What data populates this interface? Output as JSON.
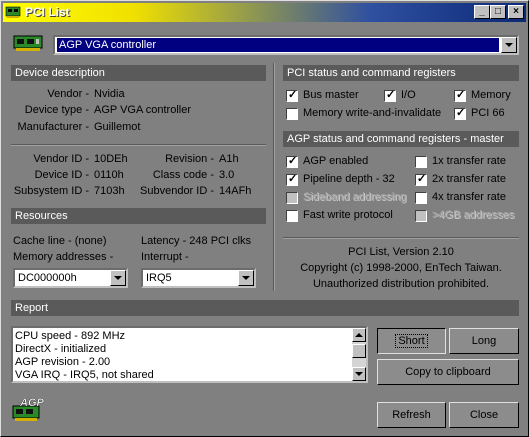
{
  "window": {
    "title": "PCI List",
    "controls": [
      "_",
      "□",
      "×"
    ]
  },
  "device_select": {
    "value": "AGP VGA controller"
  },
  "device_description": {
    "header": "Device description",
    "vendor_label": "Vendor -",
    "vendor": "Nvidia",
    "type_label": "Device type -",
    "type": "AGP VGA controller",
    "manufacturer_label": "Manufacturer -",
    "manufacturer": "Guillemot"
  },
  "ids": {
    "vendor_id_label": "Vendor ID -",
    "vendor_id": "10DEh",
    "device_id_label": "Device ID -",
    "device_id": "0110h",
    "subsystem_id_label": "Subsystem ID -",
    "subsystem_id": "7103h",
    "revision_label": "Revision -",
    "revision": "A1h",
    "class_code_label": "Class code -",
    "class_code": "3.0",
    "subvendor_id_label": "Subvendor ID -",
    "subvendor_id": "14AFh"
  },
  "resources": {
    "header": "Resources",
    "cache_line": "Cache line - (none)",
    "latency": "Latency - 248 PCI clks",
    "memory_label": "Memory addresses -",
    "memory_value": "DC000000h",
    "interrupt_label": "Interrupt -",
    "interrupt_value": "IRQ5"
  },
  "pci_status": {
    "header": "PCI status and command registers",
    "items": [
      {
        "label": "Bus master",
        "checked": true
      },
      {
        "label": "I/O",
        "checked": true
      },
      {
        "label": "Memory",
        "checked": true
      },
      {
        "label": "Memory write-and-invalidate",
        "checked": false
      },
      {
        "label": "PCI 66",
        "checked": true
      }
    ]
  },
  "agp_status": {
    "header": "AGP status and command registers - master",
    "items": [
      {
        "label": "AGP enabled",
        "checked": true,
        "enabled": true
      },
      {
        "label": "1x transfer rate",
        "checked": false,
        "enabled": true
      },
      {
        "label": "Pipeline depth - 32",
        "checked": true,
        "enabled": true
      },
      {
        "label": "2x transfer rate",
        "checked": true,
        "enabled": true
      },
      {
        "label": "Sideband addressing",
        "checked": false,
        "enabled": false
      },
      {
        "label": "4x transfer rate",
        "checked": false,
        "enabled": true
      },
      {
        "label": "Fast write protocol",
        "checked": false,
        "enabled": true
      },
      {
        "label": ">4GB addresses",
        "checked": false,
        "enabled": false
      }
    ]
  },
  "about": {
    "line1": "PCI List, Version 2.10",
    "line2": "Copyright (c) 1998-2000, EnTech Taiwan.",
    "line3": "Unauthorized distribution prohibited."
  },
  "report": {
    "header": "Report",
    "lines": [
      "CPU speed - 892 MHz",
      "DirectX - initialized",
      "AGP revision - 2.00",
      "VGA IRQ - IRQ5, not shared"
    ]
  },
  "buttons": {
    "short": "Short",
    "long": "Long",
    "copy": "Copy to clipboard",
    "refresh": "Refresh",
    "close": "Close"
  },
  "logo": {
    "text": "AGP"
  },
  "colors": {
    "title_start": "#ffff00",
    "title_end": "#0a2a78",
    "header_bg": "#5a5a5a",
    "face": "#808080",
    "selection": "#000080"
  }
}
